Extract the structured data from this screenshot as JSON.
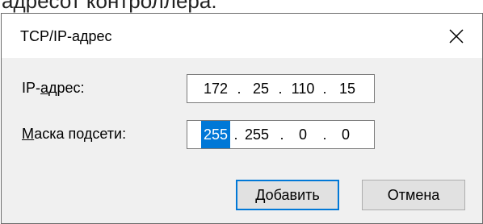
{
  "caption": "адресот контроллера.",
  "dialog": {
    "title": "TCP/IP-адрес",
    "close_icon": "close-icon"
  },
  "ip_field": {
    "label_before": "IP-",
    "label_accel": "а",
    "label_after": "дрес:",
    "octets": [
      "172",
      "25",
      "110",
      "15"
    ],
    "separator": "."
  },
  "mask_field": {
    "label_accel": "М",
    "label_after": "аска подсети:",
    "octets": [
      "255",
      "255",
      "0",
      "0"
    ],
    "selected_octet": 0,
    "separator": "."
  },
  "buttons": {
    "add_accel": "Д",
    "add_after": "обавить",
    "cancel_label": "Отмена"
  },
  "colors": {
    "selection": "#0078d7",
    "default_button_border": "#0078d7"
  }
}
